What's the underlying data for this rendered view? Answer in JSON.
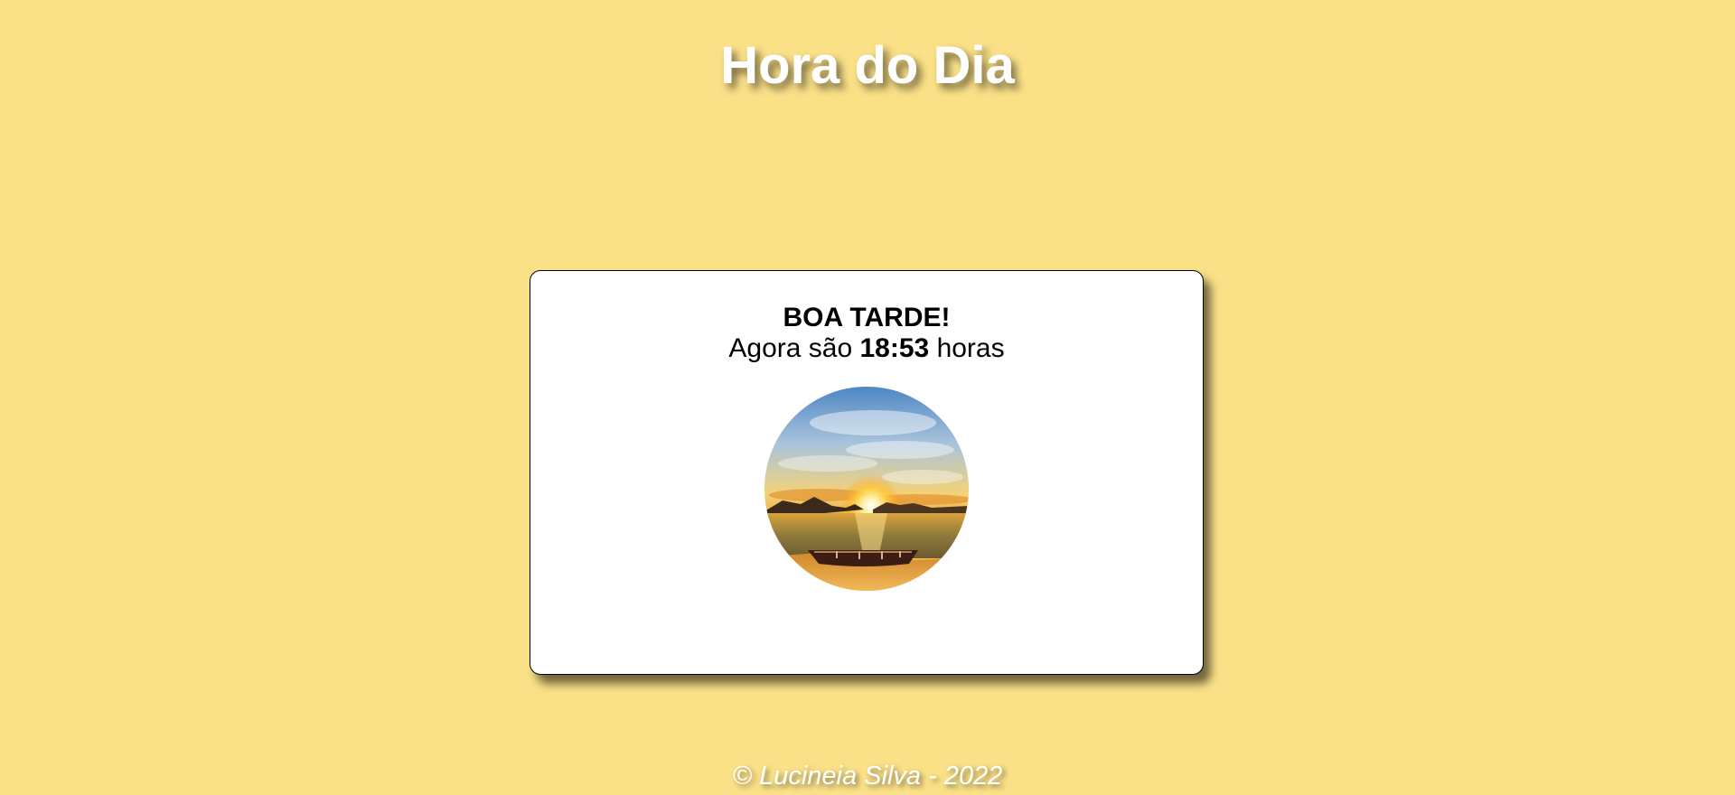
{
  "page": {
    "title": "Hora do Dia",
    "background_color": "#fae087"
  },
  "card": {
    "greeting": "BOA TARDE!",
    "time_prefix": "Agora são",
    "time_value": "18:53",
    "time_suffix": "horas",
    "image": "sunset-beach-boat"
  },
  "footer": {
    "copyright": "© Lucineia Silva - 2022"
  }
}
